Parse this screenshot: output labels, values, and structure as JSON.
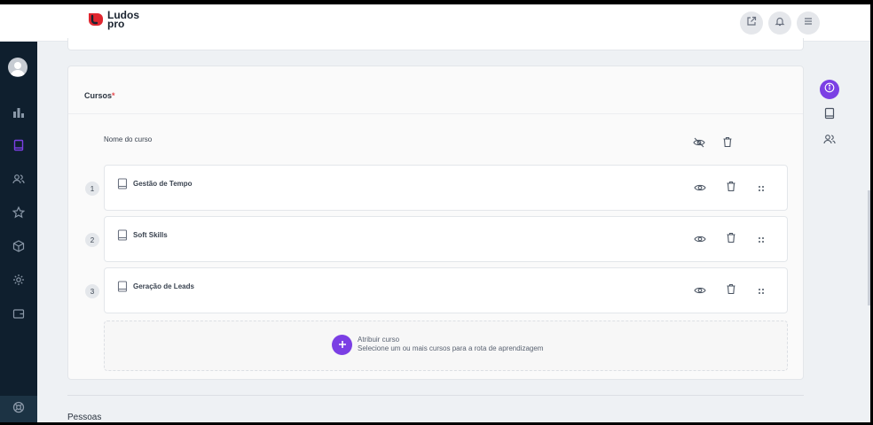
{
  "brand": {
    "line1": "Ludos",
    "line2": "pro",
    "color": "#e0262f"
  },
  "accent": "#7b3fe4",
  "header": {
    "icons": [
      "external-link-icon",
      "bell-icon",
      "menu-icon"
    ]
  },
  "sidebar": {
    "icons": [
      "avatar",
      "chart-icon",
      "book-icon",
      "users-icon",
      "star-icon",
      "box-icon",
      "gear-icon",
      "wallet-icon",
      "support-icon"
    ],
    "active": "book-icon"
  },
  "rail": {
    "icons": [
      "info-icon",
      "book-icon",
      "users-icon"
    ],
    "active": "info-icon"
  },
  "courses": {
    "title": "Cursos",
    "required_mark": "*",
    "column_header": "Nome do curso",
    "items": [
      {
        "index": "1",
        "name": "Gestão de Tempo"
      },
      {
        "index": "2",
        "name": "Soft Skills"
      },
      {
        "index": "3",
        "name": "Geração de Leads"
      }
    ],
    "add": {
      "title": "Atribuir curso",
      "subtitle": "Selecione um ou mais cursos para a rota de aprendizagem"
    }
  },
  "next_section": {
    "title": "Pessoas"
  }
}
